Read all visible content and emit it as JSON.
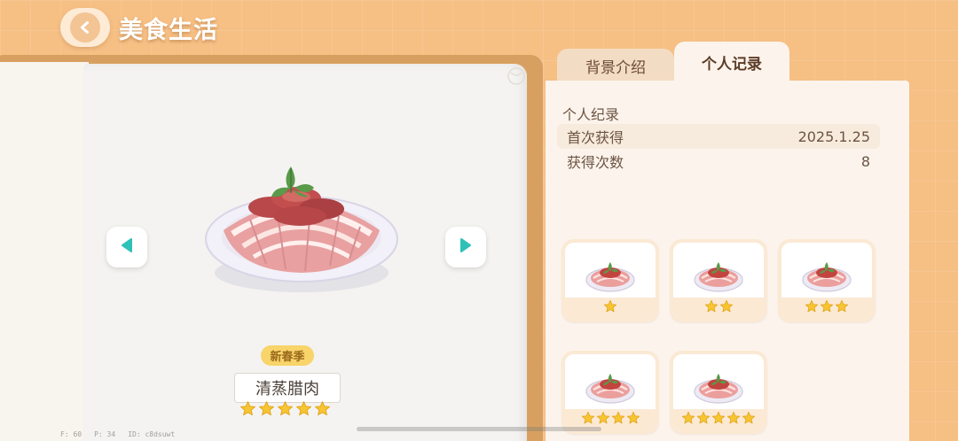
{
  "header": {
    "title": "美食生活"
  },
  "dish": {
    "season_badge": "新春季",
    "name": "清蒸腊肉",
    "rating": 5
  },
  "tabs": [
    {
      "label": "背景介绍",
      "active": false
    },
    {
      "label": "个人记录",
      "active": true
    }
  ],
  "record": {
    "title": "个人纪录",
    "rows": [
      {
        "label": "首次获得",
        "value": "2025.1.25"
      },
      {
        "label": "获得次数",
        "value": "8"
      }
    ]
  },
  "variants": [
    {
      "stars": 1
    },
    {
      "stars": 2
    },
    {
      "stars": 3
    },
    {
      "stars": 4
    },
    {
      "stars": 5
    }
  ],
  "debug": {
    "fps": "F: 60",
    "ping": "P: 34",
    "id": "ID: c8dsuwt"
  },
  "colors": {
    "background": "#f6bf84",
    "panel": "#fcf4ec",
    "star": "#f7c531",
    "accent_teal": "#2ec1b8"
  },
  "icons": {
    "back": "chevron-left-icon",
    "prev": "triangle-left-icon",
    "next": "triangle-right-icon",
    "star": "star-icon"
  }
}
